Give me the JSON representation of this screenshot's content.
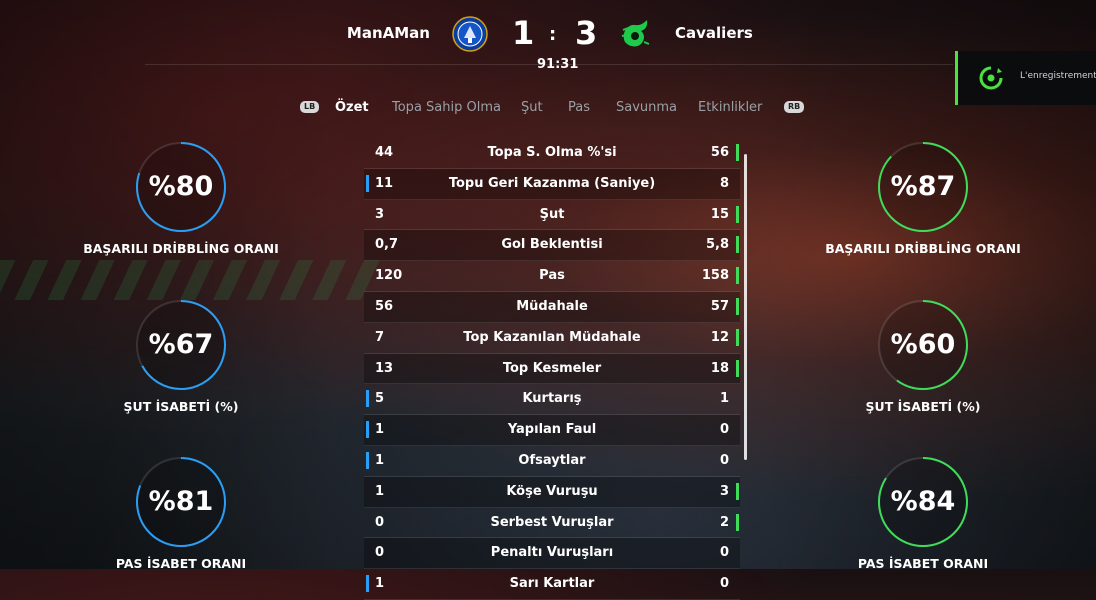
{
  "header": {
    "home_team": "ManAMan",
    "away_team": "Cavaliers",
    "home_score": "1",
    "separator": ":",
    "away_score": "3",
    "clock": "91:31",
    "home_crest": "chelsea-crest-icon",
    "away_crest": "dragon-crest-icon"
  },
  "notification": {
    "text": "L'enregistrement a",
    "icon": "recording-spinner-icon",
    "accent": "#4ce23d"
  },
  "tabs": {
    "lb": "LB",
    "rb": "RB",
    "items": [
      "Özet",
      "Topa Sahip Olma",
      "Şut",
      "Pas",
      "Savunma",
      "Etkinlikler"
    ],
    "active_index": 0
  },
  "colors": {
    "home": "#2a9df4",
    "away": "#3fdc5a"
  },
  "home_circles": [
    {
      "value": "%80",
      "label": "BAŞARILI DRİBBLİNG ORANI",
      "fraction": 0.8
    },
    {
      "value": "%67",
      "label": "ŞUT İSABETİ (%)",
      "fraction": 0.67
    },
    {
      "value": "%81",
      "label": "PAS İSABET ORANI",
      "fraction": 0.81
    }
  ],
  "away_circles": [
    {
      "value": "%87",
      "label": "BAŞARILI DRİBBLİNG ORANI",
      "fraction": 0.87
    },
    {
      "value": "%60",
      "label": "ŞUT İSABETİ (%)",
      "fraction": 0.6
    },
    {
      "value": "%84",
      "label": "PAS İSABET ORANI",
      "fraction": 0.84
    }
  ],
  "stats": [
    {
      "name": "Topa S. Olma %'si",
      "home": "44",
      "away": "56",
      "leader": "away"
    },
    {
      "name": "Topu Geri Kazanma (Saniye)",
      "home": "11",
      "away": "8",
      "leader": "home"
    },
    {
      "name": "Şut",
      "home": "3",
      "away": "15",
      "leader": "away"
    },
    {
      "name": "Gol Beklentisi",
      "home": "0,7",
      "away": "5,8",
      "leader": "away"
    },
    {
      "name": "Pas",
      "home": "120",
      "away": "158",
      "leader": "away"
    },
    {
      "name": "Müdahale",
      "home": "56",
      "away": "57",
      "leader": "away"
    },
    {
      "name": "Top Kazanılan Müdahale",
      "home": "7",
      "away": "12",
      "leader": "away"
    },
    {
      "name": "Top Kesmeler",
      "home": "13",
      "away": "18",
      "leader": "away"
    },
    {
      "name": "Kurtarış",
      "home": "5",
      "away": "1",
      "leader": "home"
    },
    {
      "name": "Yapılan Faul",
      "home": "1",
      "away": "0",
      "leader": "home"
    },
    {
      "name": "Ofsaytlar",
      "home": "1",
      "away": "0",
      "leader": "home"
    },
    {
      "name": "Köşe Vuruşu",
      "home": "1",
      "away": "3",
      "leader": "away"
    },
    {
      "name": "Serbest Vuruşlar",
      "home": "0",
      "away": "2",
      "leader": "away"
    },
    {
      "name": "Penaltı Vuruşları",
      "home": "0",
      "away": "0",
      "leader": "none"
    },
    {
      "name": "Sarı Kartlar",
      "home": "1",
      "away": "0",
      "leader": "home"
    }
  ]
}
